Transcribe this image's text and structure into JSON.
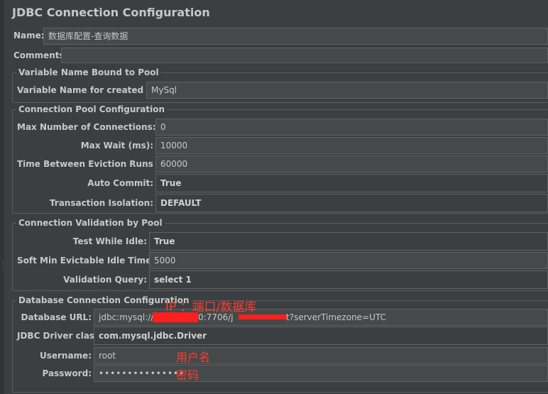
{
  "title": "JDBC Connection Configuration",
  "name": {
    "label": "Name:",
    "value": "数据库配置-查询数据"
  },
  "comments": {
    "label": "Comments:"
  },
  "variable_group": {
    "legend": "Variable Name Bound to Pool",
    "label": "Variable Name for created pool:",
    "value": "MySql"
  },
  "pool_group": {
    "legend": "Connection Pool Configuration",
    "max_connections": {
      "label": "Max Number of Connections:",
      "value": "0"
    },
    "max_wait": {
      "label": "Max Wait (ms):",
      "value": "10000"
    },
    "eviction": {
      "label": "Time Between Eviction Runs (ms):",
      "value": "60000"
    },
    "auto_commit": {
      "label": "Auto Commit:",
      "value": "True"
    },
    "isolation": {
      "label": "Transaction Isolation:",
      "value": "DEFAULT"
    }
  },
  "validation_group": {
    "legend": "Connection Validation by Pool",
    "test_idle": {
      "label": "Test While Idle:",
      "value": "True"
    },
    "soft_min": {
      "label": "Soft Min Evictable Idle Time(ms):",
      "value": "5000"
    },
    "query": {
      "label": "Validation Query:",
      "value": "select 1"
    }
  },
  "db_group": {
    "legend": "Database Connection Configuration",
    "url": {
      "label": "Database URL:",
      "prefix": "jdbc:mysql://",
      "mid": "0:7706/j",
      "suffix": "t?serverTimezone=UTC"
    },
    "driver": {
      "label": "JDBC Driver class:",
      "value": "com.mysql.jdbc.Driver"
    },
    "username": {
      "label": "Username:",
      "value": "root"
    },
    "password": {
      "label": "Password:",
      "value": "•••••••••••••••"
    }
  },
  "annotations": {
    "url_note": "IP  ：端口/数据库",
    "user_note": "用户名",
    "pass_note": "密码"
  },
  "colors": {
    "background": "#3c3f41",
    "field": "#45494a",
    "annotation": "#ff3b30",
    "redaction": "#ff1f1f"
  }
}
